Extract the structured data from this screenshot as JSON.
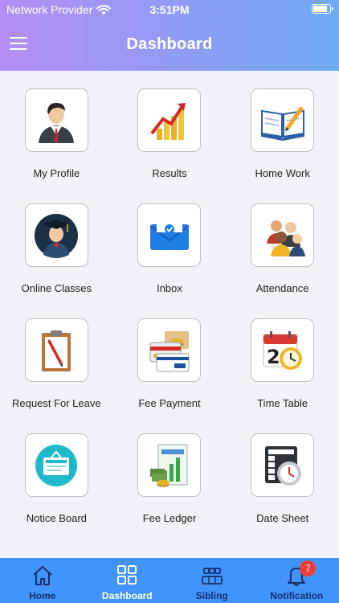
{
  "status_bar": {
    "carrier": "Network Provider",
    "time": "3:51PM",
    "battery_level": 0.9
  },
  "header": {
    "title": "Dashboard",
    "menu_icon": "hamburger-menu-icon"
  },
  "tiles": [
    {
      "label": "My Profile",
      "icon": "user-profile-icon"
    },
    {
      "label": "Results",
      "icon": "bar-chart-growth-icon"
    },
    {
      "label": "Home Work",
      "icon": "open-book-pencil-icon"
    },
    {
      "label": "Online Classes",
      "icon": "graduate-student-icon"
    },
    {
      "label": "Inbox",
      "icon": "mail-envelope-icon"
    },
    {
      "label": "Attendance",
      "icon": "people-group-icon"
    },
    {
      "label": "Request For Leave",
      "icon": "clipboard-pencil-icon"
    },
    {
      "label": "Fee Payment",
      "icon": "credit-cards-money-icon"
    },
    {
      "label": "Time Table",
      "icon": "calendar-clock-icon"
    },
    {
      "label": "Notice Board",
      "icon": "notice-board-icon"
    },
    {
      "label": "Fee Ledger",
      "icon": "ledger-chart-money-icon"
    },
    {
      "label": "Date Sheet",
      "icon": "schedule-clock-icon"
    }
  ],
  "tabbar": {
    "active": "Dashboard",
    "colors": {
      "background": "#4194fb",
      "active": "#ffffff",
      "inactive": "#16306a",
      "badge": "#ef3e36"
    },
    "tabs": [
      {
        "label": "Home",
        "icon": "home-icon"
      },
      {
        "label": "Dashboard",
        "icon": "grid-icon"
      },
      {
        "label": "Sibling",
        "icon": "siblings-icon"
      },
      {
        "label": "Notification",
        "icon": "bell-icon",
        "badge": "7"
      }
    ]
  }
}
